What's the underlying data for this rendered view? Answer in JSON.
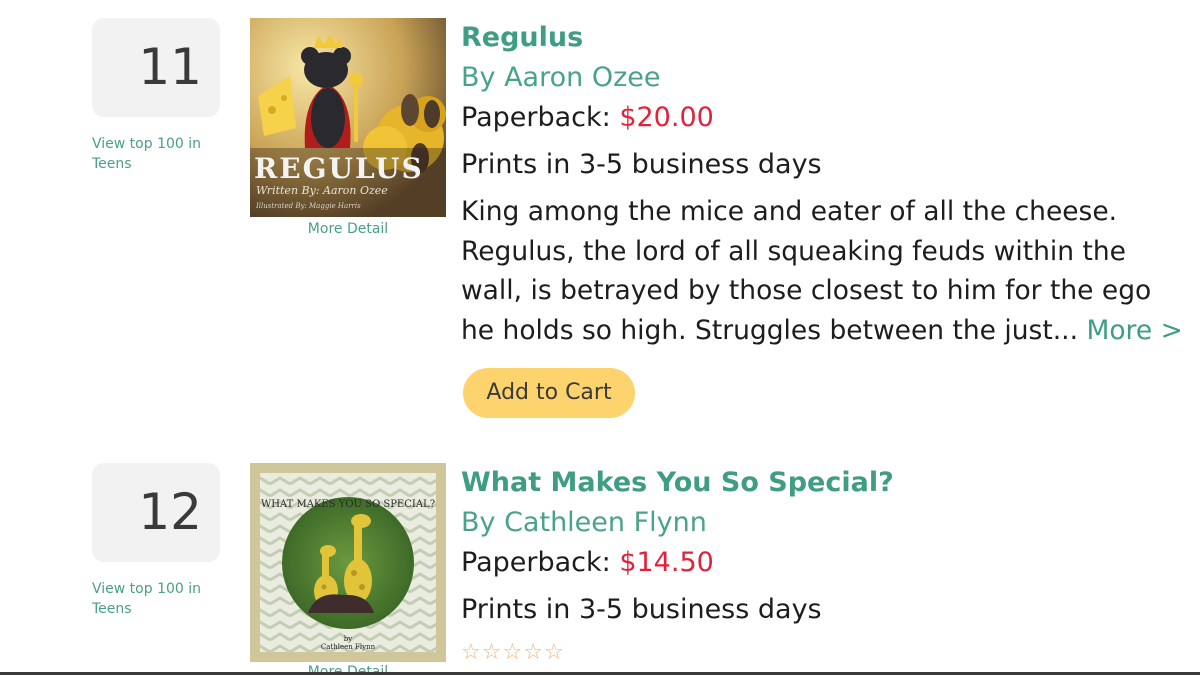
{
  "items": [
    {
      "rank": "11",
      "view_top": "View top 100 in Teens",
      "cover": {
        "title_text": "REGULUS",
        "written_by": "Written By: Aaron Ozee",
        "illustrated_by": "Illustrated By: Maggie Harris"
      },
      "more_detail": "More Detail",
      "title": "Regulus",
      "author": "By Aaron Ozee",
      "format_label": "Paperback:",
      "price": "$20.00",
      "prints": "Prints in 3-5 business days",
      "description_lines": [
        "King among the mice and eater of all the cheese.",
        "Regulus, the lord of all squeaking feuds within the",
        "wall, is betrayed by those closest to him for the ego",
        "he holds so high. Struggles between the just..."
      ],
      "more_label": "More >",
      "cart_label": "Add to Cart"
    },
    {
      "rank": "12",
      "view_top": "View top 100 in Teens",
      "cover": {
        "title_text": "WHAT MAKES YOU SO SPECIAL?",
        "by_text": "by",
        "author_text": "Cathleen Flynn"
      },
      "more_detail": "More Detail",
      "title": "What Makes You So Special?",
      "author": "By Cathleen Flynn",
      "format_label": "Paperback:",
      "price": "$14.50",
      "prints": "Prints in 3-5 business days",
      "rating_stars": 0,
      "rating_max": 5
    }
  ],
  "colors": {
    "accent": "#3f9d83",
    "price": "#e0223a",
    "button": "#fdd36e",
    "star": "#f3b273"
  }
}
